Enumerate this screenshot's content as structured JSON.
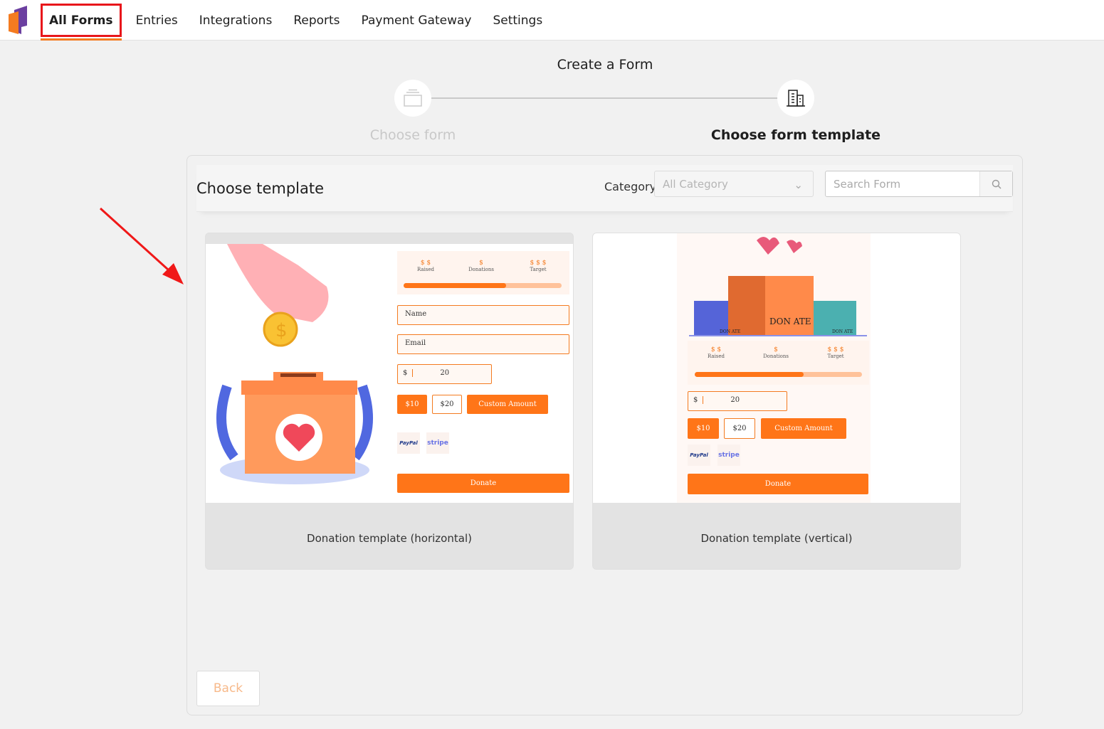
{
  "nav": {
    "items": [
      {
        "label": "All Forms",
        "active": true
      },
      {
        "label": "Entries"
      },
      {
        "label": "Integrations"
      },
      {
        "label": "Reports"
      },
      {
        "label": "Payment Gateway"
      },
      {
        "label": "Settings"
      }
    ]
  },
  "page": {
    "title": "Create a Form"
  },
  "steps": [
    {
      "label": "Choose form",
      "icon": "form-icon",
      "state": "done"
    },
    {
      "label": "Choose form template",
      "icon": "building-icon",
      "state": "active"
    }
  ],
  "panel": {
    "title": "Choose template",
    "category_label": "Category",
    "category_value": "All Category",
    "search_placeholder": "Search Form",
    "back_label": "Back"
  },
  "templates": [
    {
      "name": "Donation template (horizontal)",
      "stats": [
        {
          "v": "$ $",
          "l": "Raised"
        },
        {
          "v": "$",
          "l": "Donations"
        },
        {
          "v": "$ $ $",
          "l": "Target"
        }
      ],
      "progress": 0.65,
      "name_field": "Name",
      "email_field": "Email",
      "currency": "$",
      "amount": "20",
      "buttons": [
        "$10",
        "$20",
        "Custom Amount"
      ],
      "paypal": "PayPal",
      "stripe": "stripe",
      "donate": "Donate"
    },
    {
      "name": "Donation template (vertical)",
      "banner": "DON ATE",
      "small_banner": "DON ATE",
      "stats": [
        {
          "v": "$ $",
          "l": "Raised"
        },
        {
          "v": "$",
          "l": "Donations"
        },
        {
          "v": "$ $ $",
          "l": "Target"
        }
      ],
      "progress": 0.65,
      "currency": "$",
      "amount": "20",
      "buttons": [
        "$10",
        "$20",
        "Custom Amount"
      ],
      "paypal": "PayPal",
      "stripe": "stripe",
      "donate": "Donate"
    }
  ],
  "colors": {
    "accent": "#ff7518",
    "highlight": "#e8161b",
    "logo_purple": "#6b3fa0"
  }
}
